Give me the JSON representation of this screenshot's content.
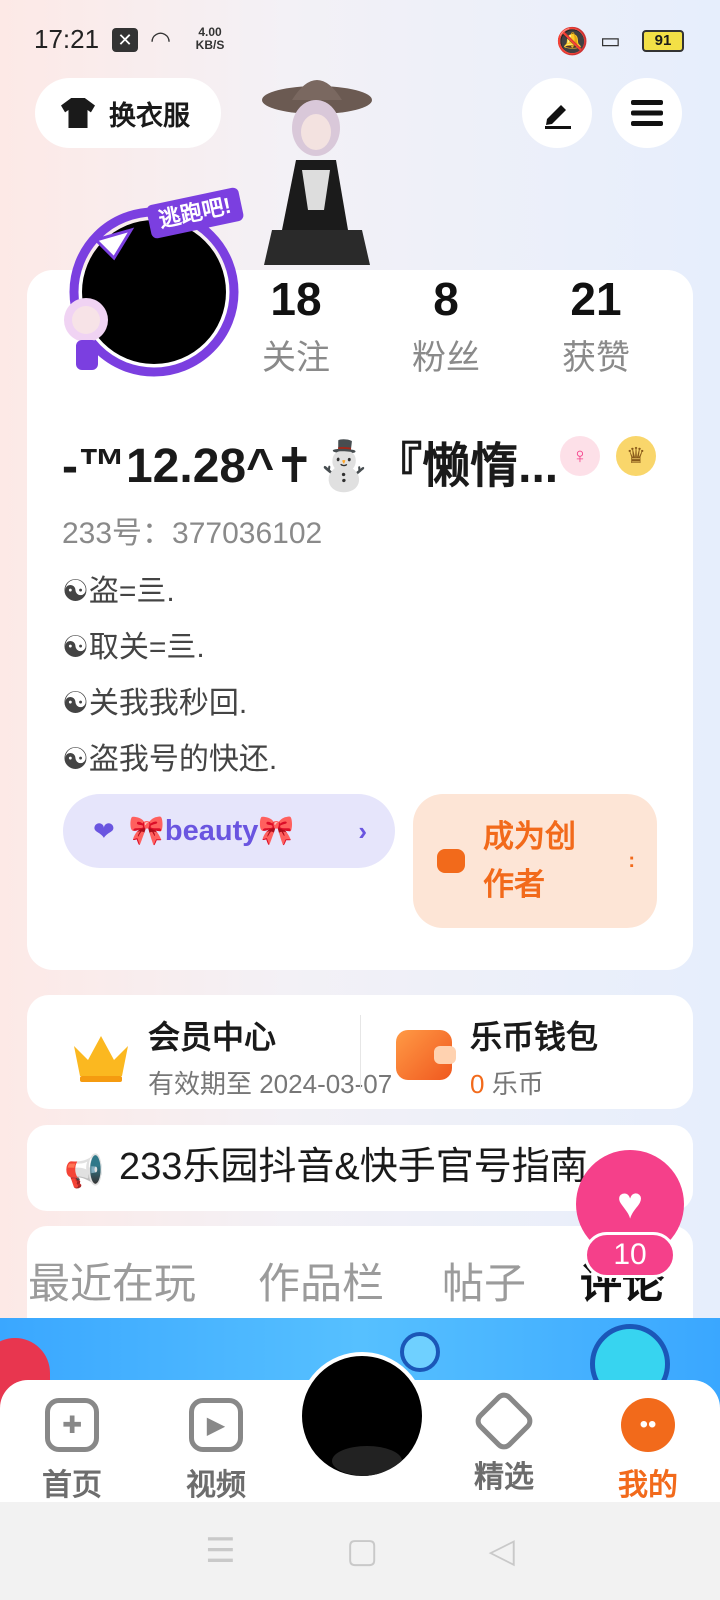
{
  "status_bar": {
    "time": "17:21",
    "net_speed_value": "4.00",
    "net_speed_unit": "KB/S",
    "battery": "91"
  },
  "top": {
    "wardrobe_label": "换衣服",
    "edit_icon": "pen-icon",
    "menu_icon": "hamburger-icon"
  },
  "profile": {
    "frame_label": "逃跑吧!",
    "stats": [
      {
        "value": "18",
        "label": "关注"
      },
      {
        "value": "8",
        "label": "粉丝"
      },
      {
        "value": "21",
        "label": "获赞"
      }
    ],
    "nickname": "-™12.28^✝⛄『懒惰...",
    "gender_icon": "female-icon",
    "crown_icon": "crown-icon",
    "uid": "233号：377036102",
    "bio": [
      "☯盗=亖.",
      "☯取关=亖.",
      "☯关我我秒回.",
      "☯盗我号的快还."
    ],
    "tag_label": "🎀beauty🎀",
    "creator_label_1": "成为创",
    "creator_label_2": "作者",
    "creator_dots": ":"
  },
  "member": {
    "title": "会员中心",
    "expiry": "有效期至 2024-03-07"
  },
  "wallet": {
    "title": "乐币钱包",
    "amount": "0",
    "unit": "乐币"
  },
  "notice": {
    "text": "233乐园抖音&快手官号指南"
  },
  "tabs": [
    "最近在玩",
    "作品栏",
    "帖子",
    "评论"
  ],
  "like": {
    "count": "10"
  },
  "nav": [
    {
      "label": "首页",
      "icon": "gamepad-icon"
    },
    {
      "label": "视频",
      "icon": "play-icon"
    },
    {
      "label": "精选",
      "icon": "heart-icon"
    },
    {
      "label": "我的",
      "icon": "profile-face-icon"
    }
  ],
  "colors": {
    "accent": "#f26a1b",
    "like": "#f5408a",
    "tag": "#6a55e0"
  }
}
